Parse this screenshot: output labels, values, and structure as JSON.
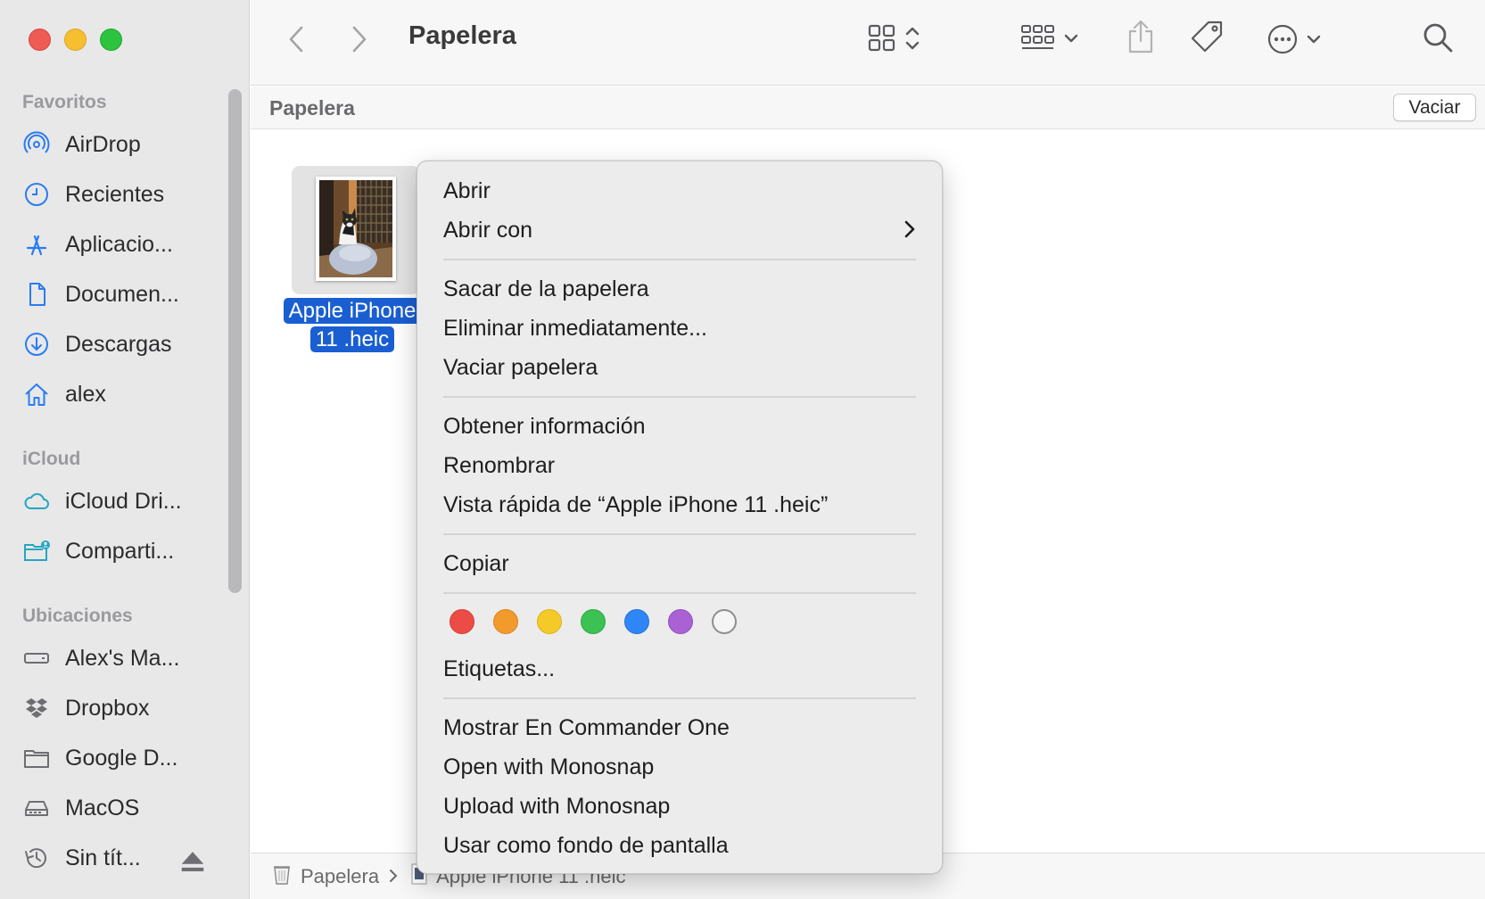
{
  "window": {
    "title": "Papelera"
  },
  "sidebar": {
    "sections": [
      {
        "title": "Favoritos"
      },
      {
        "title": "iCloud"
      },
      {
        "title": "Ubicaciones"
      }
    ],
    "items": [
      {
        "label": "AirDrop",
        "icon": "airdrop-icon"
      },
      {
        "label": "Recientes",
        "icon": "clock-icon"
      },
      {
        "label": "Aplicacio...",
        "icon": "applications-icon"
      },
      {
        "label": "Documen...",
        "icon": "document-icon"
      },
      {
        "label": "Descargas",
        "icon": "download-icon"
      },
      {
        "label": "alex",
        "icon": "home-icon"
      },
      {
        "label": "iCloud Dri...",
        "icon": "cloud-icon"
      },
      {
        "label": "Comparti...",
        "icon": "shared-folder-icon"
      },
      {
        "label": "Alex's Ma...",
        "icon": "disk-icon"
      },
      {
        "label": "Dropbox",
        "icon": "dropbox-icon"
      },
      {
        "label": "Google D...",
        "icon": "folder-icon"
      },
      {
        "label": "MacOS",
        "icon": "drive-icon"
      },
      {
        "label": "Sin tít...",
        "icon": "time-machine-icon"
      }
    ]
  },
  "pathbar": {
    "title": "Papelera",
    "empty_button": "Vaciar"
  },
  "file": {
    "name_line1": "Apple iPhone",
    "name_line2": "11 .heic"
  },
  "statusbar": {
    "crumb1": "Papelera",
    "crumb2": "Apple iPhone 11 .heic"
  },
  "context_menu": {
    "open": "Abrir",
    "open_with": "Abrir con",
    "put_back": "Sacar de la papelera",
    "delete_now": "Eliminar inmediatamente...",
    "empty_trash": "Vaciar papelera",
    "get_info": "Obtener información",
    "rename": "Renombrar",
    "quick_look": "Vista rápida de “Apple iPhone 11 .heic”",
    "copy": "Copiar",
    "tags": "Etiquetas...",
    "commander_one": "Mostrar En Commander One",
    "monosnap_open": "Open with Monosnap",
    "monosnap_upload": "Upload with Monosnap",
    "wallpaper": "Usar como fondo de pantalla",
    "tag_colors": [
      "#ec4c46",
      "#f39a2d",
      "#f5c927",
      "#3cc153",
      "#2f86f6",
      "#a961d4",
      "none"
    ]
  },
  "colors": {
    "accent": "#1a5fd2",
    "sidebar_icon": "#2a7cf0",
    "icloud_icon": "#27a6c2"
  }
}
